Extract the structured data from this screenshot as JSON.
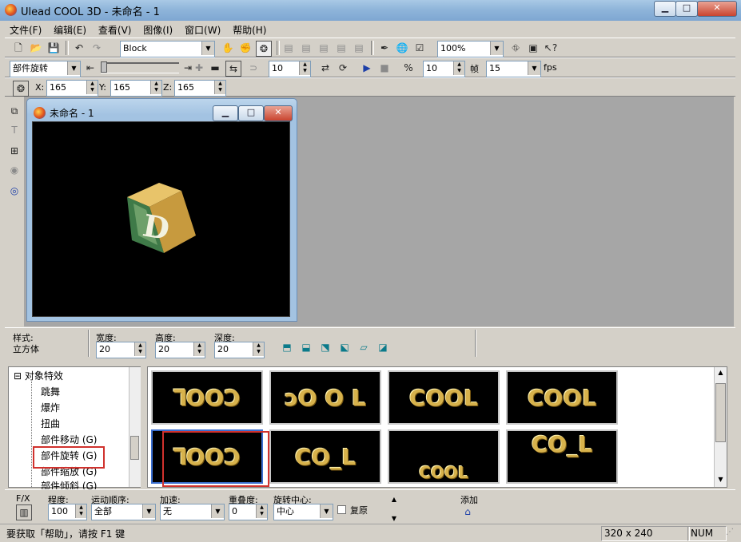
{
  "window": {
    "title": "Ulead COOL 3D - 未命名 - 1"
  },
  "menu": [
    "文件(F)",
    "编辑(E)",
    "查看(V)",
    "图像(I)",
    "窗口(W)",
    "帮助(H)"
  ],
  "toolbar1": {
    "object_name": "Block",
    "zoom": "100%"
  },
  "toolbar2": {
    "effect_mode": "部件旋转",
    "frame_value": "10",
    "speed_value": "10",
    "frame_label": "帧",
    "fps_value": "15",
    "fps_label": "fps"
  },
  "toolbar3": {
    "x_label": "X:",
    "x_value": "165",
    "y_label": "Y:",
    "y_value": "165",
    "z_label": "Z:",
    "z_value": "165"
  },
  "document": {
    "title": "未命名 - 1",
    "object_letter": "D"
  },
  "properties": {
    "style_label": "样式:",
    "style_value": "立方体",
    "width_label": "宽度:",
    "width_value": "20",
    "height_label": "高度:",
    "height_value": "20",
    "depth_label": "深度:",
    "depth_value": "20"
  },
  "tree": {
    "root": "对象特效",
    "items": [
      "跳舞",
      "爆炸",
      "扭曲",
      "部件移动 (G)",
      "部件旋转 (G)",
      "部件缩放 (G)",
      "部件倾斜 (G)"
    ],
    "selected": "部件旋转 (G)"
  },
  "thumbnails": [
    "ꓶOOƆ",
    "ɔO O L",
    "COOL",
    "COOL",
    "ꓶOOƆ",
    "CO_L",
    "COOL",
    "CO_L"
  ],
  "fx": {
    "fx_label": "F/X",
    "degree_label": "程度:",
    "degree_value": "100",
    "order_label": "运动顺序:",
    "order_value": "全部",
    "accel_label": "加速:",
    "accel_value": "无",
    "overlap_label": "重叠度:",
    "overlap_value": "0",
    "center_label": "旋转中心:",
    "center_value": "中心",
    "restore_label": "复原",
    "add_label": "添加"
  },
  "status": {
    "message": "要获取「帮助」，请按 F1 键",
    "size": "320 x 240",
    "num": "NUM"
  },
  "colors": {
    "title_bar": "#8fb5da",
    "selection_box": "#d0312d",
    "thumb_text": "#d7b24c"
  }
}
